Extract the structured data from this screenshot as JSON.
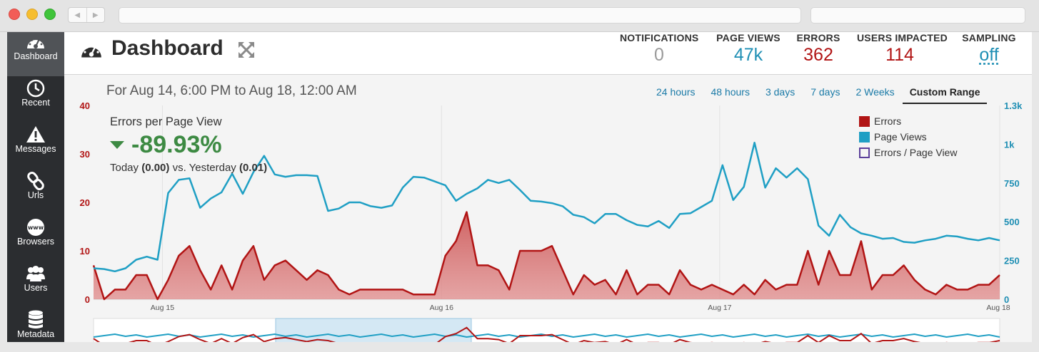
{
  "sidebar": {
    "items": [
      {
        "label": "Dashboard",
        "icon": "gauge-icon",
        "active": true
      },
      {
        "label": "Recent",
        "icon": "clock-icon"
      },
      {
        "label": "Messages",
        "icon": "warning-icon"
      },
      {
        "label": "Urls",
        "icon": "link-icon"
      },
      {
        "label": "Browsers",
        "icon": "globe-icon"
      },
      {
        "label": "Users",
        "icon": "users-icon"
      },
      {
        "label": "Metadata",
        "icon": "database-icon"
      }
    ]
  },
  "header": {
    "title": "Dashboard",
    "stats": [
      {
        "label": "NOTIFICATIONS",
        "value": "0",
        "color": "#9a9a9a"
      },
      {
        "label": "PAGE VIEWS",
        "value": "47k",
        "color": "#1f8fb4"
      },
      {
        "label": "ERRORS",
        "value": "362",
        "color": "#b11414"
      },
      {
        "label": "USERS IMPACTED",
        "value": "114",
        "color": "#b11414"
      },
      {
        "label": "SAMPLING",
        "value": "off",
        "color": "#1f8fb4"
      }
    ]
  },
  "main": {
    "range_title": "For Aug 14, 6:00 PM to Aug 18, 12:00 AM",
    "tabs": [
      {
        "label": "24 hours"
      },
      {
        "label": "48 hours"
      },
      {
        "label": "3 days"
      },
      {
        "label": "7 days"
      },
      {
        "label": "2 Weeks"
      },
      {
        "label": "Custom Range",
        "active": true
      }
    ],
    "metric": {
      "title": "Errors per Page View",
      "value": "-89.93%",
      "compare_prefix": "Today",
      "today": "(0.00)",
      "compare_mid": "vs. Yesterday",
      "yesterday": "(0.01)"
    }
  },
  "chart_data": {
    "type": "area",
    "x_ticks": [
      "Aug 15",
      "Aug 16",
      "Aug 17",
      "Aug 18"
    ],
    "y_left": {
      "ticks": [
        "0",
        "10",
        "20",
        "30",
        "40"
      ],
      "range": [
        0,
        40
      ],
      "color": "#b11414"
    },
    "y_right": {
      "ticks": [
        "0",
        "250",
        "500",
        "750",
        "1k",
        "1.3k"
      ],
      "range": [
        0,
        1250
      ],
      "color": "#1f8fb4"
    },
    "legend": [
      {
        "name": "Errors",
        "color": "#b11414",
        "style": "filled"
      },
      {
        "name": "Page Views",
        "color": "#1f8fb4",
        "style": "filled"
      },
      {
        "name": "Errors / Page View",
        "color": "#5b3f9a",
        "style": "outline"
      }
    ],
    "series": [
      {
        "name": "Errors",
        "axis": "left",
        "values": [
          7,
          0,
          2,
          2,
          5,
          5,
          0,
          4,
          9,
          11,
          6,
          2,
          7,
          2,
          8,
          11,
          4,
          7,
          8,
          6,
          4,
          6,
          5,
          2,
          1,
          2,
          2,
          2,
          2,
          2,
          1,
          1,
          1,
          9,
          12,
          18,
          7,
          7,
          6,
          2,
          10,
          10,
          10,
          11,
          6,
          1,
          5,
          3,
          4,
          1,
          6,
          1,
          3,
          3,
          1,
          6,
          3,
          2,
          3,
          2,
          1,
          3,
          1,
          4,
          2,
          3,
          3,
          10,
          3,
          10,
          5,
          5,
          12,
          2,
          5,
          5,
          7,
          4,
          2,
          1,
          3,
          2,
          2,
          3,
          3,
          5
        ]
      },
      {
        "name": "Page Views",
        "axis": "right",
        "values": [
          200,
          195,
          180,
          200,
          255,
          275,
          255,
          685,
          770,
          780,
          590,
          650,
          690,
          810,
          680,
          820,
          925,
          805,
          790,
          800,
          800,
          795,
          570,
          585,
          625,
          625,
          600,
          590,
          605,
          720,
          790,
          785,
          760,
          735,
          635,
          680,
          715,
          770,
          750,
          770,
          705,
          635,
          630,
          620,
          600,
          545,
          530,
          490,
          550,
          550,
          510,
          480,
          470,
          505,
          460,
          550,
          555,
          595,
          635,
          865,
          640,
          725,
          1010,
          720,
          845,
          785,
          845,
          775,
          475,
          410,
          545,
          465,
          425,
          410,
          390,
          395,
          370,
          365,
          380,
          390,
          410,
          405,
          390,
          380,
          395,
          380
        ]
      }
    ]
  }
}
